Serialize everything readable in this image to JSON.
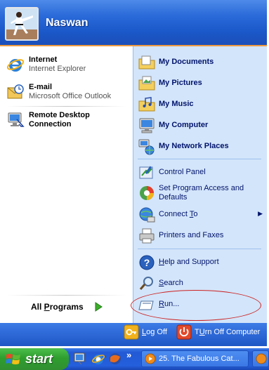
{
  "user": {
    "name": "Naswan"
  },
  "pinned": [
    {
      "title": "Internet",
      "subtitle": "Internet Explorer",
      "icon": "internet-explorer-icon"
    },
    {
      "title": "E-mail",
      "subtitle": "Microsoft Office Outlook",
      "icon": "outlook-icon"
    }
  ],
  "recent": [
    {
      "title": "Remote Desktop",
      "subtitle": "Connection",
      "icon": "remote-desktop-icon"
    }
  ],
  "all_programs": {
    "prefix": "All ",
    "accel": "P",
    "rest": "rograms",
    "icon": "green-arrow-icon"
  },
  "places": [
    {
      "label": "My Documents",
      "icon": "my-documents-icon"
    },
    {
      "label": "My Pictures",
      "icon": "my-pictures-icon"
    },
    {
      "label": "My Music",
      "icon": "my-music-icon"
    },
    {
      "label": "My Computer",
      "icon": "my-computer-icon"
    },
    {
      "label": "My Network Places",
      "icon": "my-network-places-icon"
    }
  ],
  "system": [
    {
      "label": "Control Panel",
      "icon": "control-panel-icon"
    },
    {
      "label": "Set Program Access and",
      "label2": "Defaults",
      "icon": "program-access-icon"
    },
    {
      "pre": "Connect ",
      "accel": "T",
      "post": "o",
      "icon": "connect-to-icon",
      "submenu": "▶"
    },
    {
      "label": "Printers and Faxes",
      "icon": "printers-icon"
    }
  ],
  "help": [
    {
      "accel": "H",
      "post": "elp and Support",
      "icon": "help-icon"
    },
    {
      "accel": "S",
      "post": "earch",
      "icon": "search-icon"
    },
    {
      "accel": "R",
      "post": "un...",
      "icon": "run-icon"
    }
  ],
  "bottom": {
    "logoff": {
      "accel": "L",
      "post": "og Off",
      "icon": "log-off-icon"
    },
    "turnoff": {
      "accel": "U",
      "pre": "T",
      "post": "rn Off Computer",
      "icon": "turn-off-icon"
    }
  },
  "taskbar": {
    "start_label": "start",
    "chevron": "»",
    "tasks": [
      {
        "label": "25. The Fabulous Cat...",
        "icon": "media-player-icon"
      }
    ]
  },
  "colors": {
    "header_accent": "#ef9b40",
    "menu_blue": "#1f5fcf",
    "right_panel": "#d3e5fa",
    "start_green": "#3aa93a",
    "annotation_ellipse": "#cc2222"
  }
}
